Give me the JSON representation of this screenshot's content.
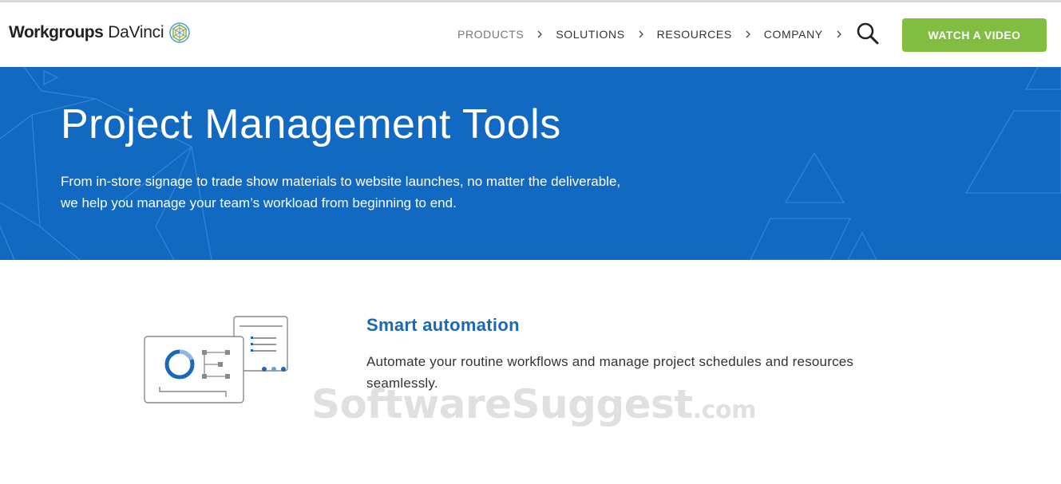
{
  "brand": {
    "name_strong": "Workgroups",
    "name_light": "DaVinci",
    "logo_icon": "geodesic-sphere-icon"
  },
  "nav": {
    "items": [
      {
        "label": "PRODUCTS",
        "active": true
      },
      {
        "label": "SOLUTIONS",
        "active": false
      },
      {
        "label": "RESOURCES",
        "active": false
      },
      {
        "label": "COMPANY",
        "active": false
      }
    ],
    "search_icon": "search-icon",
    "cta_label": "WATCH A VIDEO"
  },
  "hero": {
    "title": "Project Management Tools",
    "subtitle": "From in-store signage to trade show materials to website launches, no matter the deliverable, we help you manage your team’s workload from beginning to end."
  },
  "feature": {
    "title": "Smart automation",
    "description": "Automate your routine workflows and manage project schedules and resources seamlessly.",
    "icon": "workflow-automation-icon"
  },
  "watermark": {
    "text": "SoftwareSuggest",
    "suffix": ".com"
  },
  "colors": {
    "hero_bg": "#1169c1",
    "cta_bg": "#80bd41",
    "feature_title": "#1a68b8"
  }
}
